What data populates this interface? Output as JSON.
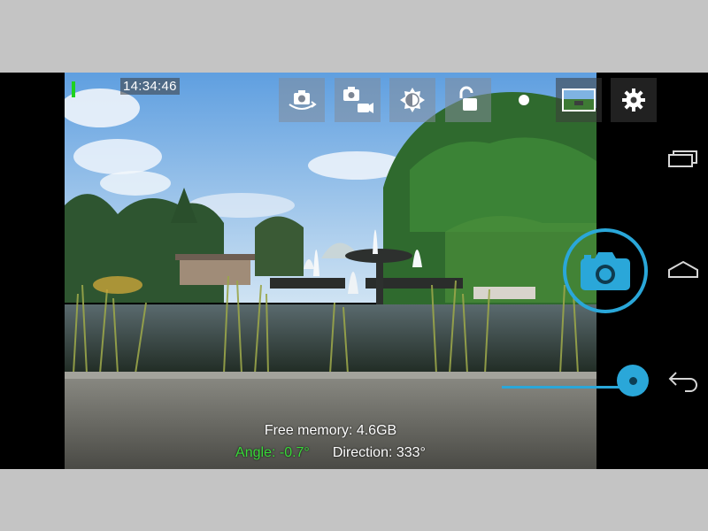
{
  "status": {
    "time": "14:34:46"
  },
  "toolbar": {
    "buttons": [
      {
        "name": "switch-camera",
        "icon": "camera-rotate-icon"
      },
      {
        "name": "photo-video-mode",
        "icon": "camera-video-icon"
      },
      {
        "name": "exposure",
        "icon": "exposure-icon"
      },
      {
        "name": "exposure-lock",
        "icon": "unlock-icon"
      },
      {
        "name": "focus",
        "icon": "focus-dot-icon"
      },
      {
        "name": "gallery",
        "icon": "gallery-thumbnail-icon"
      },
      {
        "name": "settings",
        "icon": "gear-icon"
      }
    ]
  },
  "overlay": {
    "free_memory": "Free memory: 4.6GB",
    "angle": "Angle: -0.7°",
    "direction": "Direction: 333°"
  },
  "zoom": {
    "level": 0.86
  },
  "navigation": {
    "recent_apps": "recent-apps-icon",
    "home": "home-icon",
    "back": "back-icon"
  },
  "colors": {
    "accent": "#2aa7d9",
    "angle_text": "#38d938",
    "battery": "#1fd21f"
  }
}
